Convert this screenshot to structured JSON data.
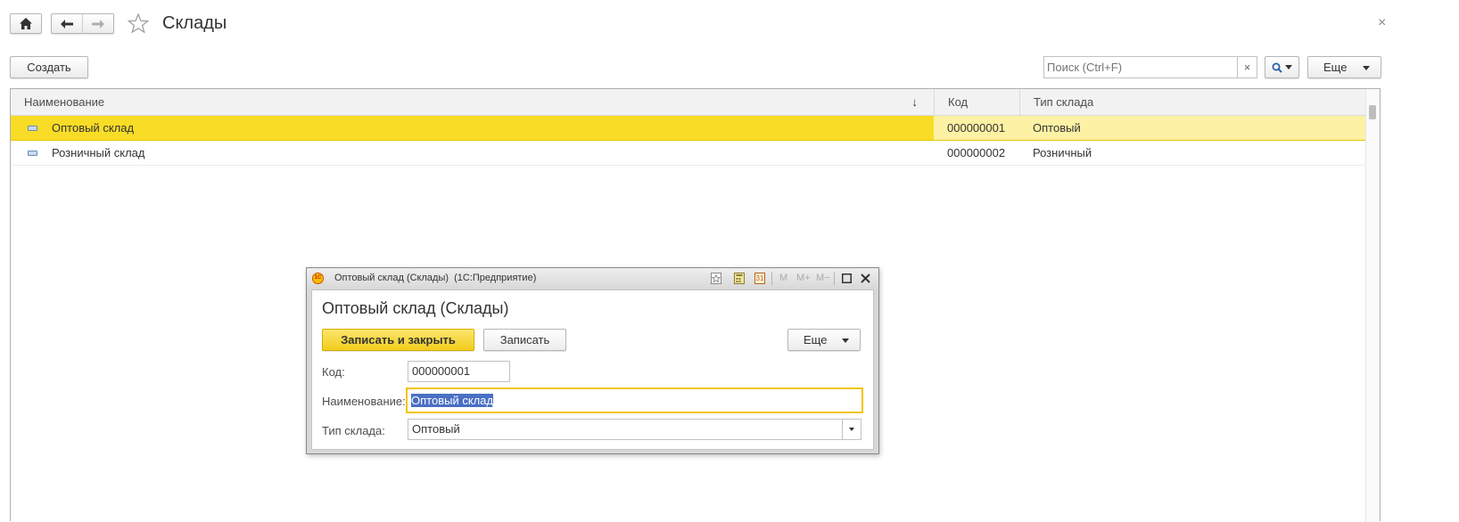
{
  "header": {
    "title": "Склады",
    "close_glyph": "×"
  },
  "toolbar": {
    "create_label": "Создать",
    "search_placeholder": "Поиск (Ctrl+F)",
    "search_clear_glyph": "×",
    "more_label": "Еще"
  },
  "table": {
    "columns": [
      "Наименование",
      "Код",
      "Тип склада"
    ],
    "sort_glyph": "↓",
    "rows": [
      {
        "name": "Оптовый склад",
        "code": "000000001",
        "type": "Оптовый",
        "selected": true
      },
      {
        "name": "Розничный склад",
        "code": "000000002",
        "type": "Розничный",
        "selected": false
      }
    ]
  },
  "dialog": {
    "window_title": "Оптовый склад (Склады)  (1С:Предприятие)",
    "logo_text": "1С",
    "heading": "Оптовый склад (Склады)",
    "memory_buttons": [
      "M",
      "M+",
      "M−"
    ],
    "calendar_day": "31",
    "save_close_label": "Записать и закрыть",
    "save_label": "Записать",
    "more_label": "Еще",
    "fields": {
      "code_label": "Код:",
      "code_value": "000000001",
      "name_label": "Наименование:",
      "name_value": "Оптовый склад",
      "type_label": "Тип склада:",
      "type_value": "Оптовый"
    }
  },
  "colors": {
    "selected_row": "#f9dc26",
    "selected_row_light": "#fdf1a4",
    "primary_button": "#f5d227",
    "focus_border": "#f2c500",
    "text_selection": "#4a6fc4"
  },
  "icons": [
    "home-icon",
    "arrow-left-icon",
    "arrow-right-icon",
    "star-icon",
    "search-icon",
    "close-icon",
    "dropdown-arrow-icon"
  ]
}
